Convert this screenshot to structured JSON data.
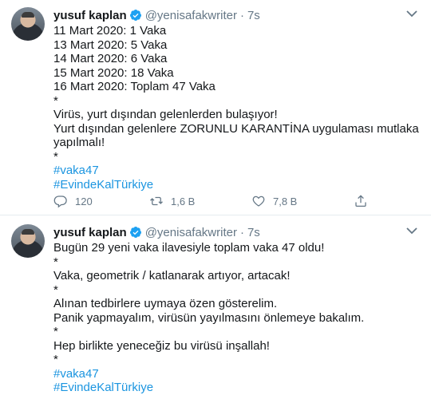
{
  "tweets": [
    {
      "author_name": "yusuf kaplan",
      "handle": "@yenisafakwriter",
      "separator": "·",
      "time": "7s",
      "lines": [
        "11 Mart 2020: 1 Vaka",
        "13 Mart 2020: 5 Vaka",
        "14 Mart 2020: 6 Vaka",
        "15 Mart 2020: 18 Vaka",
        "16 Mart 2020: Toplam 47 Vaka",
        "*",
        "Virüs, yurt dışından gelenlerden bulaşıyor!",
        "Yurt dışından gelenlere ZORUNLU KARANTİNA uygulaması mutlaka",
        "yapılmalı!",
        "*",
        "#vaka47",
        "#EvindeKalTürkiye"
      ],
      "hashtag_lines": [
        10,
        11
      ],
      "replies": "120",
      "retweets": "1,6 B",
      "likes": "7,8 B"
    },
    {
      "author_name": "yusuf kaplan",
      "handle": "@yenisafakwriter",
      "separator": "·",
      "time": "7s",
      "lines": [
        "Bugün 29 yeni vaka ilavesiyle toplam vaka 47 oldu!",
        "*",
        "Vaka, geometrik / katlanarak artıyor, artacak!",
        "*",
        "Alınan tedbirlere uymaya özen gösterelim.",
        "Panik yapmayalım, virüsün yayılmasını önlemeye bakalım.",
        "*",
        "Hep birlikte yeneceğiz bu virüsü inşallah!",
        "*",
        "#vaka47",
        "#EvindeKalTürkiye"
      ],
      "hashtag_lines": [
        9,
        10
      ]
    }
  ],
  "colors": {
    "accent": "#1da1f2",
    "hashtag": "#1b95e0",
    "muted": "#657786"
  },
  "icons": [
    "verified-badge-icon",
    "chevron-down-icon",
    "reply-icon",
    "retweet-icon",
    "like-icon",
    "share-icon"
  ]
}
